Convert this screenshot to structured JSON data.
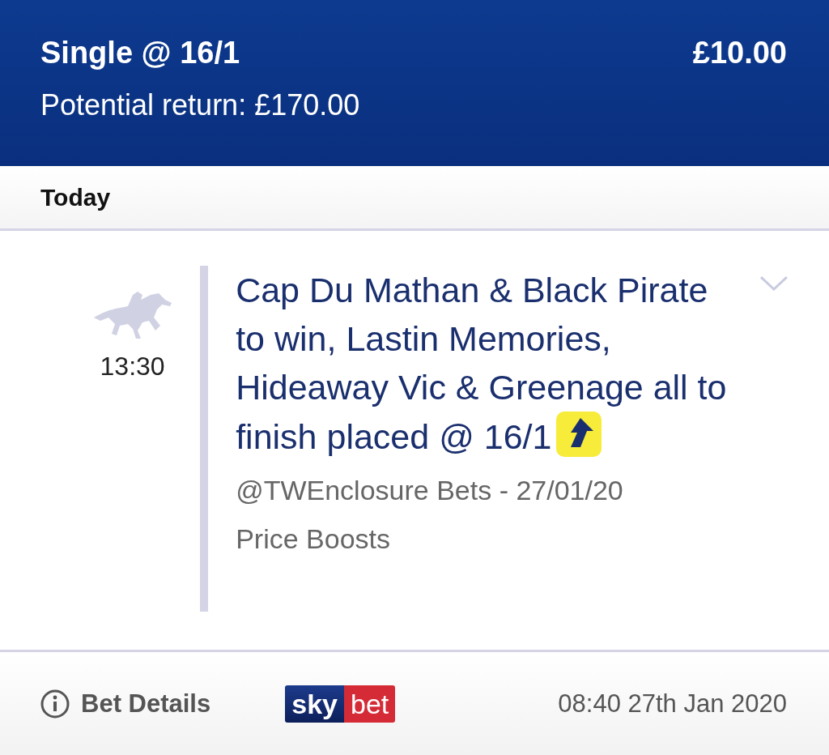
{
  "header": {
    "title": "Single @ 16/1",
    "stake": "£10.00",
    "potential_return": "Potential return: £170.00"
  },
  "section": {
    "title": "Today"
  },
  "bet": {
    "time": "13:30",
    "selection": "Cap Du Mathan & Black Pirate to win, Lastin Memories, Hideaway Vic & Greenage all to finish placed @ 16/1",
    "boosted": true,
    "market": "@TWEnclosure Bets - 27/01/20",
    "category": "Price Boosts"
  },
  "footer": {
    "details_link": "Bet Details",
    "logo": [
      "sky",
      "bet"
    ],
    "placed_at": "08:40 27th Jan 2020"
  }
}
